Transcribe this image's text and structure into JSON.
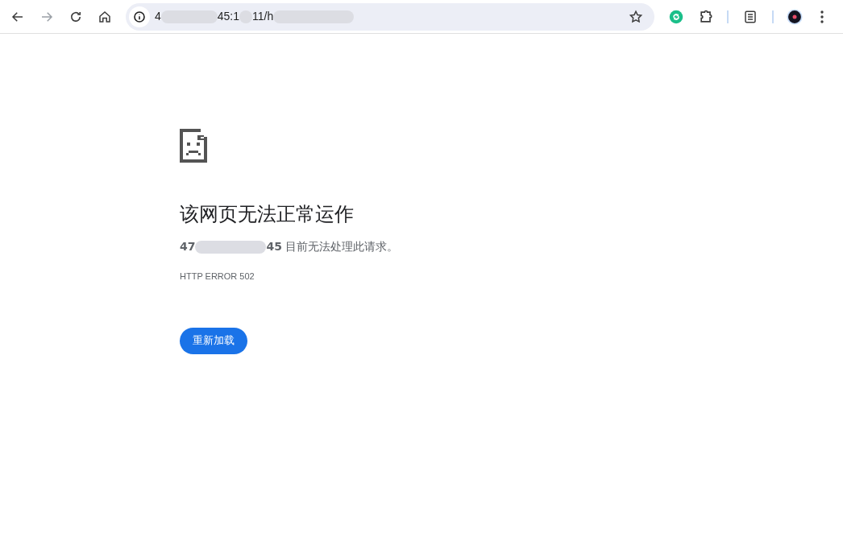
{
  "toolbar": {
    "back": {
      "disabled": false
    },
    "forward": {
      "disabled": true
    }
  },
  "address": {
    "parts": [
      {
        "kind": "text",
        "text": "4"
      },
      {
        "kind": "redacted"
      },
      {
        "kind": "text",
        "text": "45:1"
      },
      {
        "kind": "redacted"
      },
      {
        "kind": "text",
        "text": "11/h"
      },
      {
        "kind": "redacted"
      }
    ]
  },
  "page": {
    "title": "该网页无法正常运作",
    "message": {
      "parts": [
        {
          "kind": "bold",
          "text": "47"
        },
        {
          "kind": "redacted"
        },
        {
          "kind": "bold",
          "text": "45"
        },
        {
          "kind": "text",
          "text": " 目前无法处理此请求。"
        }
      ]
    },
    "error_code": "HTTP ERROR 502",
    "reload_button": "重新加载"
  }
}
